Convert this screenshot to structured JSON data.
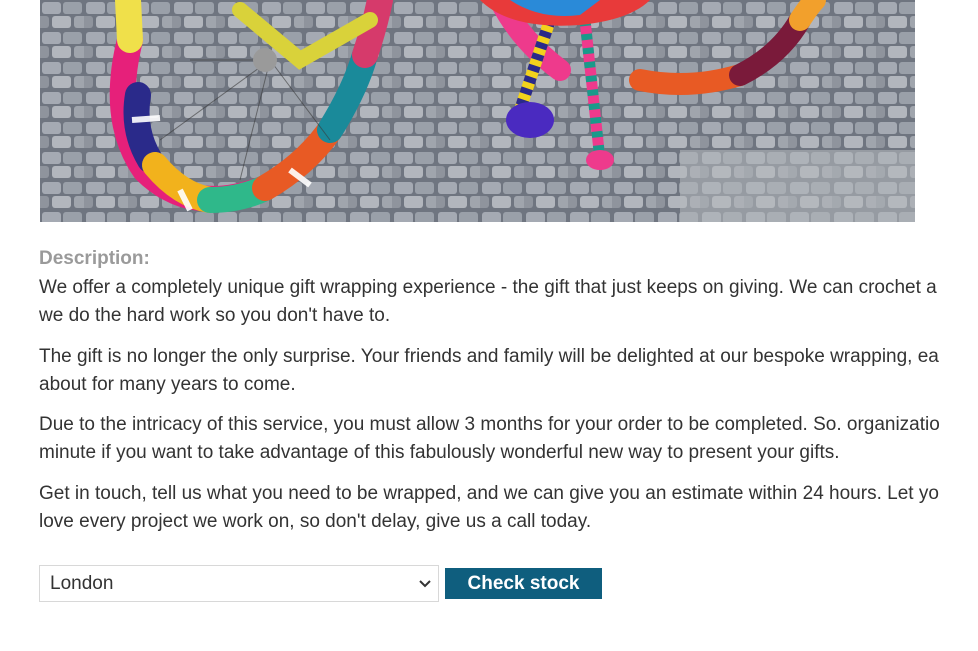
{
  "product": {
    "image_alt": "yarn-bombed bicycle on cobblestones"
  },
  "description": {
    "label": "Description:",
    "paragraphs": [
      {
        "line1": "We offer a completely unique gift wrapping experience - the gift that just keeps on giving. We can crochet a",
        "line2": "we do the hard work so you don't have to."
      },
      {
        "line1": "The gift is no longer the only surprise. Your friends and family will be delighted at our bespoke wrapping, ea",
        "line2": "about for many years to come."
      },
      {
        "line1": "Due to the intricacy of this service, you must allow 3 months for your order to be completed. So. organizatio",
        "line2": "minute if you want to take advantage of this fabulously wonderful new way to present your gifts."
      },
      {
        "line1": "Get in touch, tell us what you need to be wrapped, and we can give you an estimate within 24 hours. Let yo",
        "line2": "love every project we work on, so don't delay, give us a call today."
      }
    ]
  },
  "stock_check": {
    "selected_store": "London",
    "button_label": "Check stock"
  },
  "colors": {
    "button_bg": "#0f5e7e",
    "label_gray": "#9a9a9a",
    "text": "#333333"
  }
}
